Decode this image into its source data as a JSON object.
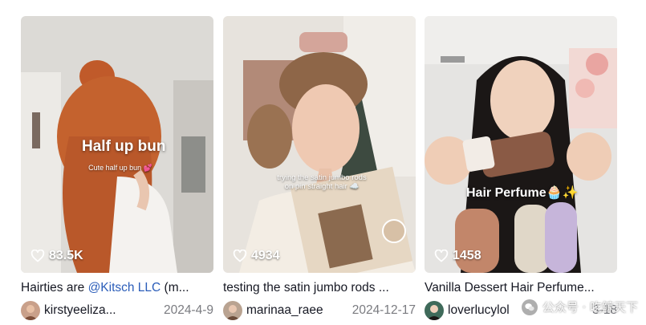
{
  "cards": [
    {
      "overlay_title": "Half up bun",
      "overlay_sub": "Cute half up bun 💕",
      "likes": "83.5K",
      "caption_prefix": "Hairties are ",
      "caption_mention": "@Kitsch LLC",
      "caption_suffix": " (m...",
      "username": "kirstyeeliza...",
      "date": "2024-4-9"
    },
    {
      "overlay_sub": "trying the satin jumbo rods on pin straight hair ☁️",
      "likes": "4934",
      "caption": "testing the satin jumbo rods ...",
      "username": "marinaa_raee",
      "date": "2024-12-17"
    },
    {
      "overlay_title": "Hair Perfume🧁✨",
      "likes": "1458",
      "caption": "Vanilla Dessert Hair Perfume...",
      "username": "loverlucylol",
      "date": "3-18"
    }
  ],
  "watermark": {
    "text": "公众号 · 吃鲸天下"
  },
  "colors": {
    "mention": "#2b5db9",
    "date": "#7a7b80",
    "text": "#161823"
  },
  "icons": {
    "likes": "heart-outline-icon",
    "watermark": "wechat-icon"
  }
}
